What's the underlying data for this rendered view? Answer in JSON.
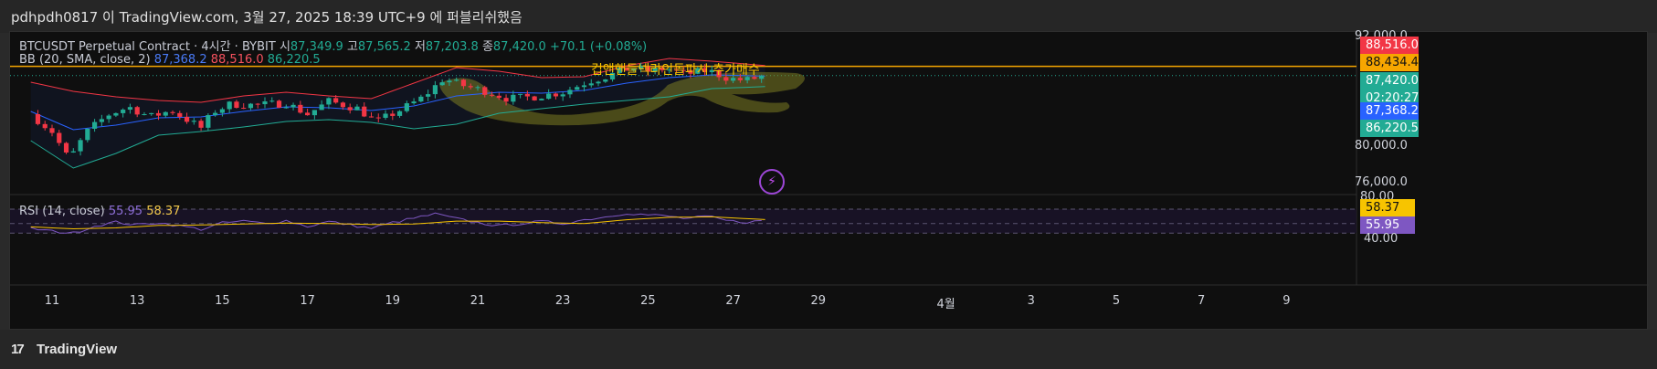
{
  "header": {
    "caption": "pdhpdh0817 이 TradingView.com, 3월 27, 2025 18:39 UTC+9 에 퍼블리쉬했음"
  },
  "legend": {
    "symbol": "BTCUSDT Perpetual Contract · 4시간 · BYBIT",
    "o_label": "시",
    "o_value": "87,349.9",
    "h_label": "고",
    "h_value": "87,565.2",
    "l_label": "저",
    "l_value": "87,203.8",
    "c_label": "종",
    "c_value": "87,420.0",
    "change": "+70.1 (+0.08%)",
    "bb_label": "BB (20, SMA, close, 2)",
    "bb_basis": "87,368.2",
    "bb_upper": "88,516.0",
    "bb_lower": "86,220.5",
    "rsi_label": "RSI (14, close)",
    "rsi_value": "55.95",
    "rsi_ma": "58.37"
  },
  "annotation": "컵앤핸들넥라인돌파시 추가매수",
  "price_tags": {
    "upper": "88,516.0",
    "hline": "88,434.4",
    "last": "87,420.0",
    "countdown": "02:20:27",
    "basis": "87,368.2",
    "lower": "86,220.5",
    "rsi_ma": "58.37",
    "rsi": "55.95"
  },
  "y_axis_labels": [
    "92,000.0",
    "80,000.0",
    "76,000.0"
  ],
  "rsi_axis_labels": [
    "80.00",
    "40.00"
  ],
  "x_axis_labels": [
    "11",
    "13",
    "15",
    "17",
    "19",
    "21",
    "23",
    "25",
    "27",
    "29",
    "4월",
    "3",
    "5",
    "7",
    "9"
  ],
  "footer": {
    "brand": "TradingView",
    "logo_glyph": "17"
  },
  "colors": {
    "up": "#22ab94",
    "down": "#f23645",
    "bb_basis": "#2962ff",
    "bb_upper": "#f23645",
    "bb_lower": "#22ab94",
    "hline": "#f7a600",
    "rsi": "#7e57c2",
    "rsi_ma": "#f7c400",
    "highlight": "#7b7b22"
  },
  "chart_data": {
    "type": "candlestick",
    "symbol": "BTCUSDT",
    "timeframe": "4시간",
    "y_range": [
      75000,
      92000
    ],
    "horizontal_line": 88434.4,
    "x_ticks": [
      "11",
      "13",
      "15",
      "17",
      "19",
      "21",
      "23",
      "25",
      "27",
      "29",
      "4월",
      "3",
      "5",
      "7",
      "9"
    ],
    "x_tick_day_index": [
      0,
      2,
      4,
      6,
      8,
      10,
      12,
      14,
      16,
      18,
      21,
      23,
      25,
      27,
      29
    ],
    "first_day": 10.5,
    "last_day": 27.75,
    "close_path": [
      [
        10.5,
        83200
      ],
      [
        11.0,
        81300
      ],
      [
        11.4,
        78200
      ],
      [
        11.8,
        81200
      ],
      [
        12.3,
        83100
      ],
      [
        12.8,
        84000
      ],
      [
        13.3,
        82900
      ],
      [
        13.8,
        83600
      ],
      [
        14.5,
        81700
      ],
      [
        14.8,
        83500
      ],
      [
        15.2,
        84300
      ],
      [
        15.8,
        84200
      ],
      [
        16.5,
        84400
      ],
      [
        17.0,
        83200
      ],
      [
        17.5,
        84600
      ],
      [
        18.2,
        83800
      ],
      [
        18.6,
        82300
      ],
      [
        19.2,
        83700
      ],
      [
        19.7,
        85000
      ],
      [
        20.2,
        87100
      ],
      [
        20.6,
        86400
      ],
      [
        21.2,
        85700
      ],
      [
        21.7,
        84900
      ],
      [
        22.3,
        85100
      ],
      [
        23.0,
        85600
      ],
      [
        23.6,
        86800
      ],
      [
        24.0,
        87300
      ],
      [
        24.6,
        88300
      ],
      [
        25.0,
        87900
      ],
      [
        25.4,
        88200
      ],
      [
        25.9,
        87600
      ],
      [
        26.4,
        88000
      ],
      [
        26.9,
        87100
      ],
      [
        27.3,
        86900
      ],
      [
        27.75,
        87420
      ]
    ],
    "bb_points": [
      [
        10.5,
        83500,
        86700,
        80300
      ],
      [
        11.5,
        81500,
        85700,
        77300
      ],
      [
        12.5,
        82000,
        85100,
        78900
      ],
      [
        13.5,
        82800,
        84700,
        80900
      ],
      [
        14.5,
        82900,
        84500,
        81300
      ],
      [
        15.5,
        83500,
        85200,
        81800
      ],
      [
        16.5,
        84000,
        85600,
        82400
      ],
      [
        17.5,
        83900,
        85200,
        82600
      ],
      [
        18.5,
        83600,
        84900,
        82300
      ],
      [
        19.5,
        84100,
        86600,
        81600
      ],
      [
        20.5,
        85200,
        88300,
        82100
      ],
      [
        21.5,
        85600,
        87900,
        83300
      ],
      [
        22.5,
        85500,
        87200,
        83800
      ],
      [
        23.5,
        85800,
        87300,
        84300
      ],
      [
        24.5,
        86600,
        88500,
        84700
      ],
      [
        25.5,
        87200,
        89300,
        85100
      ],
      [
        26.5,
        87500,
        89000,
        86000
      ],
      [
        27.75,
        87368,
        88516,
        86220
      ]
    ],
    "rsi_range": [
      20,
      90
    ],
    "rsi_points": [
      [
        10.5,
        40
      ],
      [
        11.0,
        34
      ],
      [
        11.5,
        30
      ],
      [
        12.0,
        45
      ],
      [
        12.5,
        53
      ],
      [
        13.0,
        47
      ],
      [
        13.5,
        52
      ],
      [
        14.0,
        45
      ],
      [
        14.5,
        38
      ],
      [
        15.0,
        51
      ],
      [
        15.5,
        55
      ],
      [
        16.0,
        50
      ],
      [
        16.5,
        56
      ],
      [
        17.0,
        44
      ],
      [
        17.5,
        54
      ],
      [
        18.0,
        47
      ],
      [
        18.5,
        40
      ],
      [
        19.0,
        52
      ],
      [
        19.5,
        61
      ],
      [
        20.0,
        70
      ],
      [
        20.5,
        60
      ],
      [
        21.0,
        52
      ],
      [
        21.5,
        45
      ],
      [
        22.0,
        50
      ],
      [
        22.5,
        54
      ],
      [
        23.0,
        50
      ],
      [
        23.5,
        58
      ],
      [
        24.0,
        64
      ],
      [
        24.5,
        72
      ],
      [
        25.0,
        68
      ],
      [
        25.4,
        66
      ],
      [
        25.9,
        60
      ],
      [
        26.4,
        65
      ],
      [
        26.9,
        55
      ],
      [
        27.3,
        53
      ],
      [
        27.75,
        55.95
      ]
    ],
    "rsi_ma_points": [
      [
        10.5,
        43
      ],
      [
        11.5,
        39
      ],
      [
        12.5,
        41
      ],
      [
        13.5,
        46
      ],
      [
        14.5,
        47
      ],
      [
        15.5,
        49
      ],
      [
        16.5,
        51
      ],
      [
        17.5,
        50
      ],
      [
        18.5,
        48
      ],
      [
        19.5,
        49
      ],
      [
        20.5,
        55
      ],
      [
        21.5,
        55
      ],
      [
        22.5,
        52
      ],
      [
        23.5,
        50
      ],
      [
        24.5,
        58
      ],
      [
        25.5,
        63
      ],
      [
        26.5,
        64
      ],
      [
        27.75,
        58.37
      ]
    ]
  }
}
